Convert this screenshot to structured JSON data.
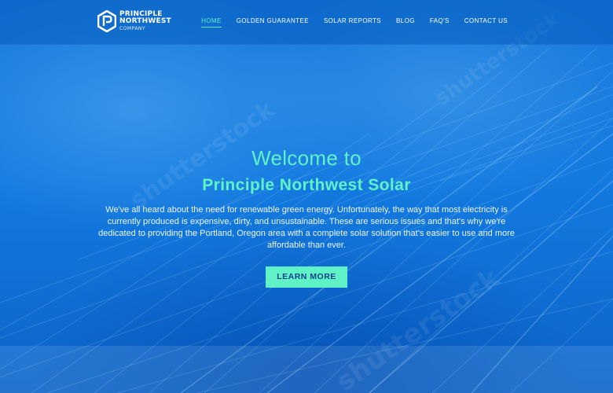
{
  "brand": {
    "line1": "PRINCIPLE",
    "line2": "NORTHWEST",
    "line3": "COMPANY",
    "logo_icon": "hexagon-p-icon"
  },
  "nav": {
    "items": [
      {
        "label": "HOME",
        "active": true
      },
      {
        "label": "GOLDEN GUARANTEE",
        "active": false
      },
      {
        "label": "SOLAR REPORTS",
        "active": false
      },
      {
        "label": "BLOG",
        "active": false
      },
      {
        "label": "FAQ'S",
        "active": false
      },
      {
        "label": "CONTACT US",
        "active": false
      }
    ]
  },
  "hero": {
    "subtitle": "Welcome to",
    "title": "Principle Northwest Solar",
    "text": "We've all heard about the need for renewable green energy. Unfortunately, the way that most electricity is currently produced is expensive, dirty, and unsustainable. These are serious issues and that's why we're dedicated to providing the Portland, Oregon area with a complete solar solution that's easier to use and more affordable than ever.",
    "cta_label": "LEARN MORE"
  },
  "watermark": {
    "text": "shutterstock"
  },
  "colors": {
    "accent": "#5ff2c6",
    "background": "#137ae0",
    "header": "#0a5cbd",
    "button_text": "#11418a"
  }
}
